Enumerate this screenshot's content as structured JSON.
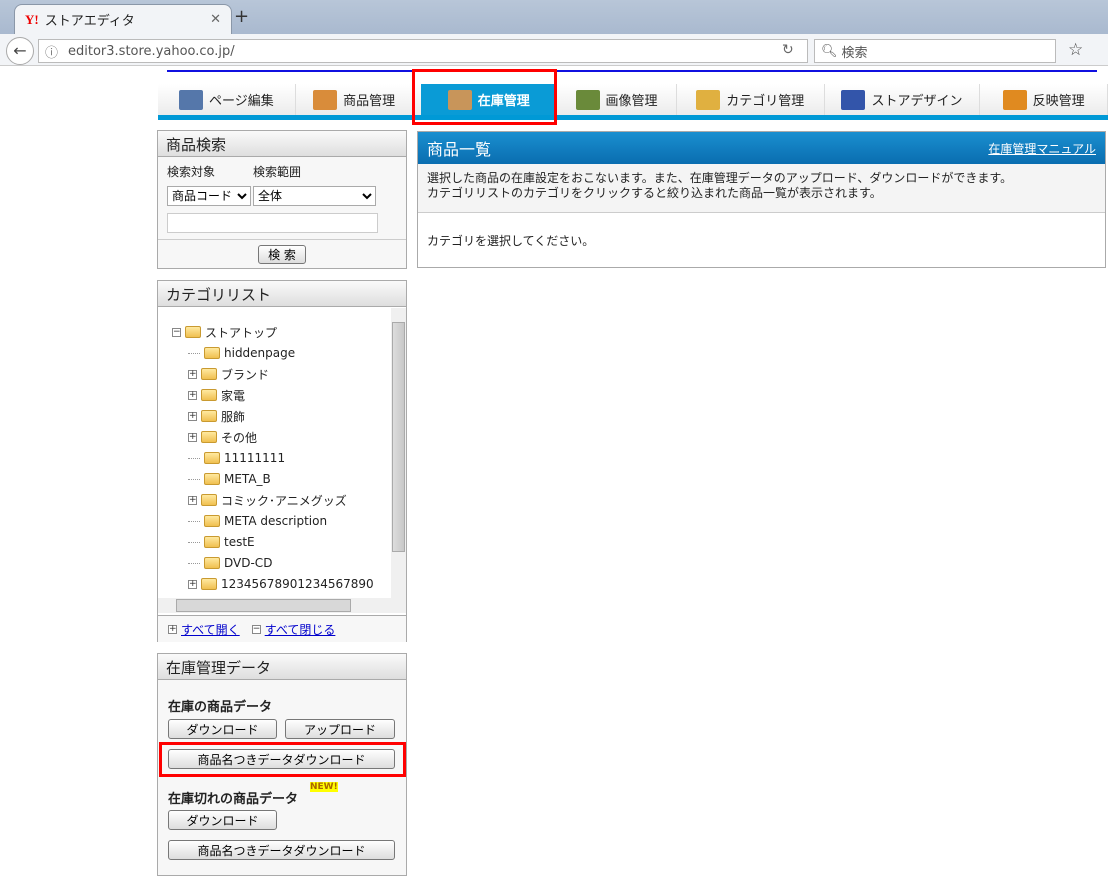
{
  "browser": {
    "tab_title": "ストアエディタ",
    "logo": "Y!",
    "url": "editor3.store.yahoo.co.jp/",
    "search_placeholder": "検索"
  },
  "nav": {
    "tabs": [
      {
        "label": "ページ編集",
        "icon": "page-edit-icon",
        "color": "#5577aa"
      },
      {
        "label": "商品管理",
        "icon": "clipboard-icon",
        "color": "#d98c3a"
      },
      {
        "label": "在庫管理",
        "icon": "boxes-icon",
        "color": "#c8955a",
        "selected": true
      },
      {
        "label": "画像管理",
        "icon": "image-icon",
        "color": "#6a8a3a"
      },
      {
        "label": "カテゴリ管理",
        "icon": "category-tree-icon",
        "color": "#e0b040"
      },
      {
        "label": "ストアデザイン",
        "icon": "design-grid-icon",
        "color": "#3355aa"
      },
      {
        "label": "反映管理",
        "icon": "publish-icon",
        "color": "#e08a20"
      }
    ]
  },
  "search_panel": {
    "title": "商品検索",
    "target_label": "検索対象",
    "scope_label": "検索範囲",
    "target_value": "商品コード",
    "scope_value": "全体",
    "keyword": "",
    "search_button": "検 索"
  },
  "category_panel": {
    "title": "カテゴリリスト",
    "root": "ストアトップ",
    "items": [
      {
        "label": "hiddenpage",
        "expandable": false
      },
      {
        "label": "ブランド",
        "expandable": true
      },
      {
        "label": "家電",
        "expandable": true
      },
      {
        "label": "服飾",
        "expandable": true
      },
      {
        "label": "その他",
        "expandable": true
      },
      {
        "label": "11111111",
        "expandable": false
      },
      {
        "label": "META_B",
        "expandable": false
      },
      {
        "label": "コミック･アニメグッズ",
        "expandable": true
      },
      {
        "label": "META description",
        "expandable": false
      },
      {
        "label": "testE",
        "expandable": false
      },
      {
        "label": "DVD-CD",
        "expandable": false
      },
      {
        "label": "12345678901234567890",
        "expandable": true
      }
    ],
    "expand_all": "すべて開く",
    "collapse_all": "すべて閉じる"
  },
  "inventory_panel": {
    "title": "在庫管理データ",
    "in_stock_heading": "在庫の商品データ",
    "download": "ダウンロード",
    "upload": "アップロード",
    "named_download": "商品名つきデータダウンロード",
    "out_of_stock_heading": "在庫切れの商品データ",
    "new_badge": "NEW!",
    "download2": "ダウンロード",
    "named_download2": "商品名つきデータダウンロード"
  },
  "main": {
    "title": "商品一覧",
    "manual_link": "在庫管理マニュアル",
    "desc1": "選択した商品の在庫設定をおこないます。また、在庫管理データのアップロード、ダウンロードができます。",
    "desc2": "カテゴリリストのカテゴリをクリックすると絞り込まれた商品一覧が表示されます。",
    "message": "カテゴリを選択してください。"
  }
}
